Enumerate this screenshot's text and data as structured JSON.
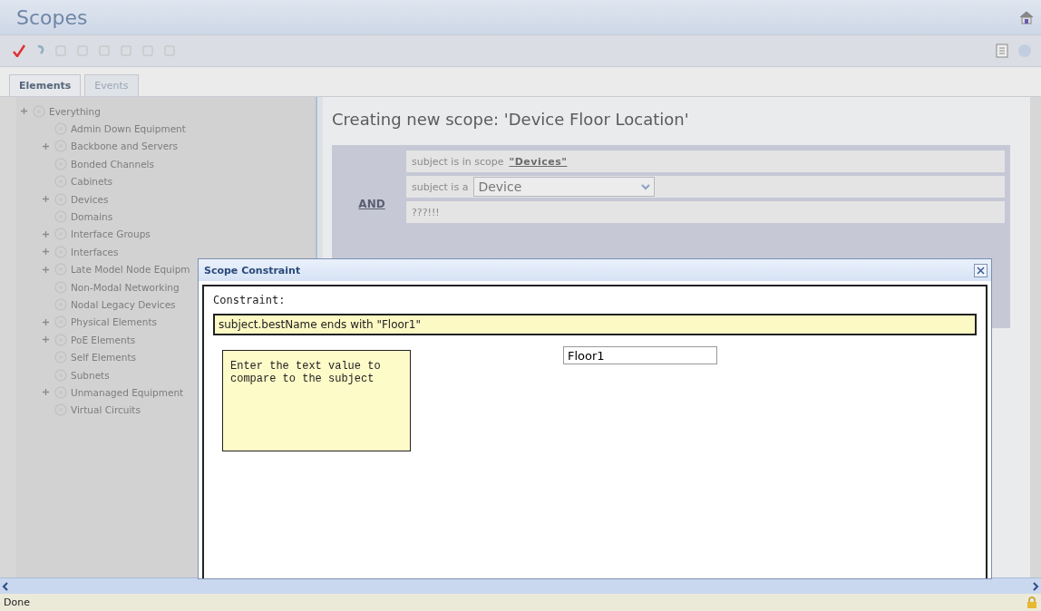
{
  "app": {
    "title": "Scopes"
  },
  "tabs": [
    {
      "label": "Elements",
      "selected": true
    },
    {
      "label": "Events",
      "selected": false
    }
  ],
  "tree": [
    {
      "label": "Everything",
      "kind": "group",
      "children": [
        {
          "label": "Admin Down Equipment",
          "kind": "leaf"
        },
        {
          "label": "Backbone and Servers",
          "kind": "group"
        },
        {
          "label": "Bonded Channels",
          "kind": "leaf"
        },
        {
          "label": "Cabinets",
          "kind": "leaf"
        },
        {
          "label": "Devices",
          "kind": "group"
        },
        {
          "label": "Domains",
          "kind": "leaf"
        },
        {
          "label": "Interface Groups",
          "kind": "group"
        },
        {
          "label": "Interfaces",
          "kind": "group"
        },
        {
          "label": "Late Model Node Equipm",
          "kind": "group"
        },
        {
          "label": "Non-Modal Networking",
          "kind": "leaf"
        },
        {
          "label": "Nodal Legacy Devices",
          "kind": "leaf"
        },
        {
          "label": "Physical Elements",
          "kind": "group"
        },
        {
          "label": "PoE Elements",
          "kind": "group"
        },
        {
          "label": "Self Elements",
          "kind": "leaf"
        },
        {
          "label": "Subnets",
          "kind": "leaf"
        },
        {
          "label": "Unmanaged Equipment",
          "kind": "group"
        },
        {
          "label": "Virtual Circuits",
          "kind": "leaf"
        }
      ]
    }
  ],
  "editor": {
    "heading": "Creating new scope: 'Device Floor Location'",
    "operator": "AND",
    "rules": [
      {
        "kind": "scope",
        "text": "subject is in scope",
        "link": "\"Devices\""
      },
      {
        "kind": "type",
        "text": "subject is a",
        "value": "Device"
      },
      {
        "kind": "plain",
        "text": "???!!!"
      }
    ]
  },
  "dialog": {
    "title": "Scope Constraint",
    "label": "Constraint:",
    "expression": "subject.bestName ends with \"Floor1\"",
    "hint": "Enter the text value to compare to the subject",
    "value": "Floor1"
  },
  "status_bar": {
    "text": "Done"
  }
}
